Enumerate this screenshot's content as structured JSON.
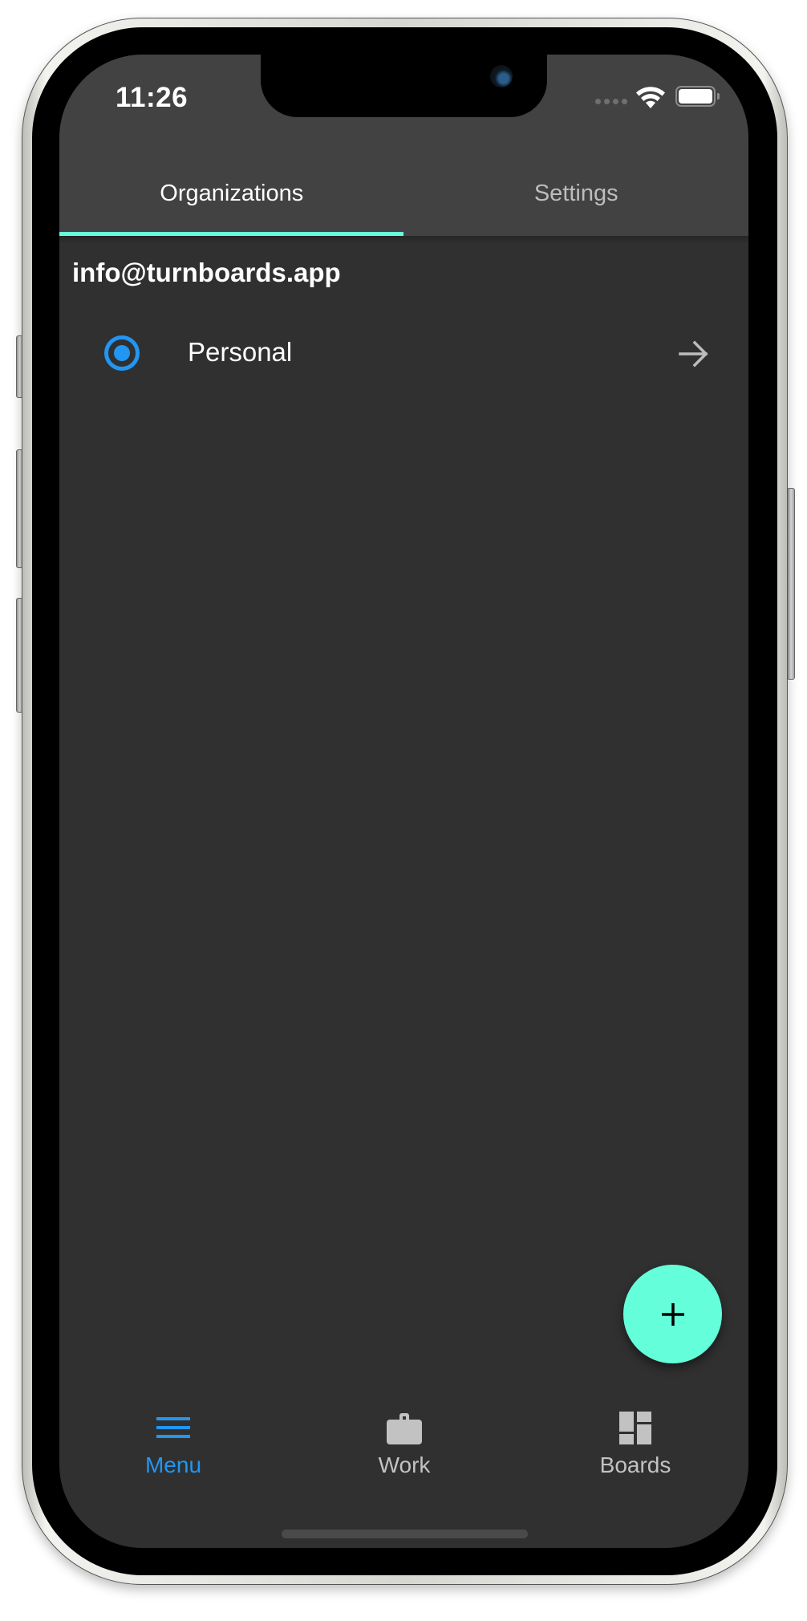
{
  "status_bar": {
    "time": "11:26",
    "icons": [
      "signal-dots-icon",
      "wifi-icon",
      "battery-icon"
    ]
  },
  "tabs": [
    {
      "label": "Organizations",
      "active": true
    },
    {
      "label": "Settings",
      "active": false
    }
  ],
  "account": {
    "email": "info@turnboards.app"
  },
  "organizations": [
    {
      "name": "Personal",
      "selected": true,
      "icon": "arrow-forward-icon"
    }
  ],
  "fab": {
    "icon": "plus-icon"
  },
  "bottom_nav": [
    {
      "label": "Menu",
      "icon": "menu-icon",
      "active": true
    },
    {
      "label": "Work",
      "icon": "briefcase-icon",
      "active": false
    },
    {
      "label": "Boards",
      "icon": "dashboard-icon",
      "active": false
    }
  ],
  "colors": {
    "accent_teal": "#64ffda",
    "selected_blue": "#2196f3",
    "header_bg": "#424242",
    "body_bg": "#303030"
  }
}
